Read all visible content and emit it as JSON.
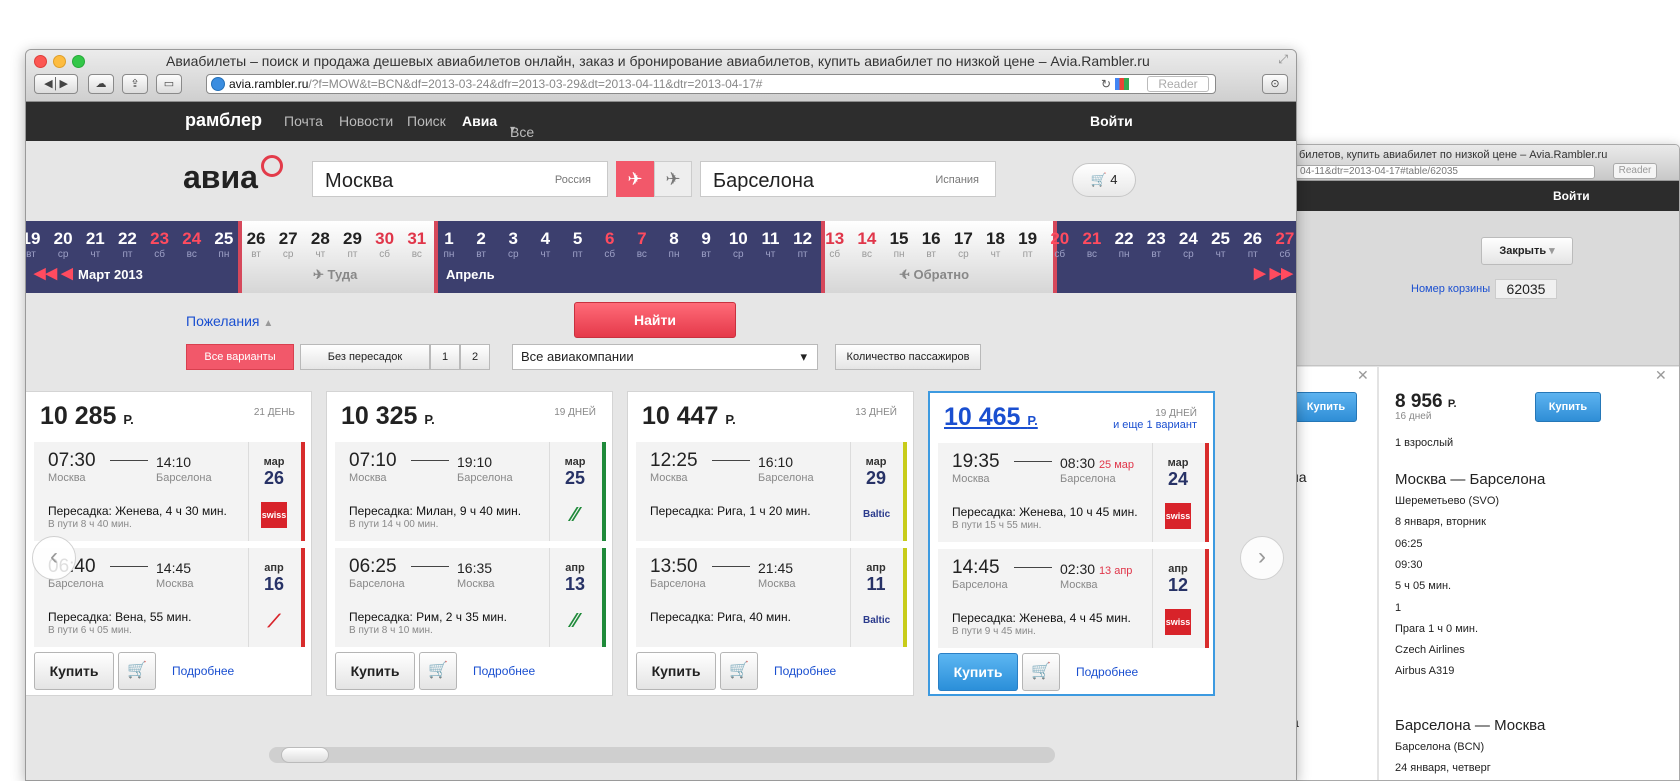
{
  "back_window": {
    "title": "билетов, купить авиабилет по низкой цене – Avia.Rambler.ru",
    "url": "04-11&dtr=2013-04-17#table/62035",
    "reader": "Reader",
    "login": "Войти",
    "close_label": "Закрыть",
    "basket_label": "Номер корзины",
    "basket_number": "62035",
    "buy_label": "Купить",
    "left_fragments": [
      "на",
      "а"
    ],
    "panel": {
      "price": "8 956",
      "currency": "Р.",
      "days": "16 дней",
      "passengers": "1 взрослый",
      "route1_title": "Москва — Барселона",
      "route1_lines": [
        "Шереметьево (SVO)",
        "8 января, вторник",
        "06:25",
        "09:30",
        "5 ч 05 мин.",
        "1",
        "Прага 1 ч 0 мин.",
        "Czech Airlines",
        "Airbus A319"
      ],
      "route2_title": "Барселона — Москва",
      "route2_lines": [
        "Барселона (BCN)",
        "24 января, четверг"
      ]
    }
  },
  "window": {
    "title": "Авиабилеты – поиск и продажа дешевых авиабилетов онлайн, заказ и бронирование авиабилетов, купить авиабилет по низкой цене – Avia.Rambler.ru",
    "url_host": "avia.rambler.ru",
    "url_rest": "/?f=MOW&t=BCN&df=2013-03-24&dfr=2013-03-29&dt=2013-04-11&dtr=2013-04-17#",
    "reader": "Reader"
  },
  "topnav": {
    "logo": "рамблер",
    "items": [
      "Почта",
      "Новости",
      "Поиск",
      "Авиа",
      "Все"
    ],
    "login": "Войти"
  },
  "search": {
    "logo": "авиа",
    "from_city": "Москва",
    "from_country": "Россия",
    "to_city": "Барселона",
    "to_country": "Испания",
    "cart_count": "4"
  },
  "dates": {
    "days": [
      {
        "n": "19",
        "w": "вт",
        "we": false
      },
      {
        "n": "20",
        "w": "ср",
        "we": false
      },
      {
        "n": "21",
        "w": "чт",
        "we": false
      },
      {
        "n": "22",
        "w": "пт",
        "we": false
      },
      {
        "n": "23",
        "w": "сб",
        "we": true
      },
      {
        "n": "24",
        "w": "вс",
        "we": true
      },
      {
        "n": "25",
        "w": "пн",
        "we": false
      },
      {
        "n": "26",
        "w": "вт",
        "we": false
      },
      {
        "n": "27",
        "w": "ср",
        "we": false
      },
      {
        "n": "28",
        "w": "чт",
        "we": false
      },
      {
        "n": "29",
        "w": "пт",
        "we": false
      },
      {
        "n": "30",
        "w": "сб",
        "we": true
      },
      {
        "n": "31",
        "w": "вс",
        "we": true
      },
      {
        "n": "1",
        "w": "пн",
        "we": false
      },
      {
        "n": "2",
        "w": "вт",
        "we": false
      },
      {
        "n": "3",
        "w": "ср",
        "we": false
      },
      {
        "n": "4",
        "w": "чт",
        "we": false
      },
      {
        "n": "5",
        "w": "пт",
        "we": false
      },
      {
        "n": "6",
        "w": "сб",
        "we": true
      },
      {
        "n": "7",
        "w": "вс",
        "we": true
      },
      {
        "n": "8",
        "w": "пн",
        "we": false
      },
      {
        "n": "9",
        "w": "вт",
        "we": false
      },
      {
        "n": "10",
        "w": "ср",
        "we": false
      },
      {
        "n": "11",
        "w": "чт",
        "we": false
      },
      {
        "n": "12",
        "w": "пт",
        "we": false
      },
      {
        "n": "13",
        "w": "сб",
        "we": true
      },
      {
        "n": "14",
        "w": "вс",
        "we": true
      },
      {
        "n": "15",
        "w": "пн",
        "we": false
      },
      {
        "n": "16",
        "w": "вт",
        "we": false
      },
      {
        "n": "17",
        "w": "ср",
        "we": false
      },
      {
        "n": "18",
        "w": "чт",
        "we": false
      },
      {
        "n": "19",
        "w": "пт",
        "we": false
      },
      {
        "n": "20",
        "w": "сб",
        "we": true
      },
      {
        "n": "21",
        "w": "вс",
        "we": true
      },
      {
        "n": "22",
        "w": "пн",
        "we": false
      },
      {
        "n": "23",
        "w": "вт",
        "we": false
      },
      {
        "n": "24",
        "w": "ср",
        "we": false
      },
      {
        "n": "25",
        "w": "чт",
        "we": false
      },
      {
        "n": "26",
        "w": "пт",
        "we": false
      },
      {
        "n": "27",
        "w": "сб",
        "we": true
      }
    ],
    "month1": "Март 2013",
    "month2": "Апрель",
    "there_label": "Туда",
    "back_label": "Обратно"
  },
  "options": {
    "wishes": "Пожелания",
    "find": "Найти",
    "all_variants": "Все варианты",
    "no_transfers": "Без пересадок",
    "one": "1",
    "two": "2",
    "airlines": "Все авиакомпании",
    "passengers": "Количество пассажиров"
  },
  "card_labels": {
    "buy": "Купить",
    "more": "Подробнее"
  },
  "cards": [
    {
      "price": "10 285",
      "cur": "Р.",
      "days": "21 ДЕНЬ",
      "extra": "",
      "legs": [
        {
          "dep": "07:30",
          "arr": "14:10",
          "arr_extra": "",
          "from": "Москва",
          "to": "Барселона",
          "transfer": "Пересадка: Женева, 4 ч 30 мин.",
          "dur": "В пути 8 ч 40 мин.",
          "mon": "мар",
          "day": "26",
          "logo": "swiss",
          "color": "#d82c2c"
        },
        {
          "dep": "06:40",
          "arr": "14:45",
          "arr_extra": "",
          "from": "Барселона",
          "to": "Москва",
          "transfer": "Пересадка: Вена, 55 мин.",
          "dur": "В пути 6 ч 05 мин.",
          "mon": "апр",
          "day": "16",
          "logo": "austrian",
          "color": "#d82c2c"
        }
      ]
    },
    {
      "price": "10 325",
      "cur": "Р.",
      "days": "19 ДНЕЙ",
      "extra": "",
      "legs": [
        {
          "dep": "07:10",
          "arr": "19:10",
          "arr_extra": "",
          "from": "Москва",
          "to": "Барселона",
          "transfer": "Пересадка: Милан, 9 ч 40 мин.",
          "dur": "В пути 14 ч 00 мин.",
          "mon": "мар",
          "day": "25",
          "logo": "alitalia",
          "color": "#1f8a3a"
        },
        {
          "dep": "06:25",
          "arr": "16:35",
          "arr_extra": "",
          "from": "Барселона",
          "to": "Москва",
          "transfer": "Пересадка: Рим, 2 ч 35 мин.",
          "dur": "В пути 8 ч 10 мин.",
          "mon": "апр",
          "day": "13",
          "logo": "alitalia",
          "color": "#1f8a3a"
        }
      ]
    },
    {
      "price": "10 447",
      "cur": "Р.",
      "days": "13 ДНЕЙ",
      "extra": "",
      "legs": [
        {
          "dep": "12:25",
          "arr": "16:10",
          "arr_extra": "",
          "from": "Москва",
          "to": "Барселона",
          "transfer": "Пересадка: Рига, 1 ч 20 мин.",
          "dur": "",
          "mon": "мар",
          "day": "29",
          "logo": "baltic",
          "color": "#c8cc1a"
        },
        {
          "dep": "13:50",
          "arr": "21:45",
          "arr_extra": "",
          "from": "Барселона",
          "to": "Москва",
          "transfer": "Пересадка: Рига, 40 мин.",
          "dur": "",
          "mon": "апр",
          "day": "11",
          "logo": "baltic",
          "color": "#c8cc1a"
        }
      ]
    },
    {
      "price": "10 465",
      "cur": "Р.",
      "days": "19 ДНЕЙ",
      "extra": "и еще 1 вариант",
      "legs": [
        {
          "dep": "19:35",
          "arr": "08:30",
          "arr_extra": "25 мар",
          "from": "Москва",
          "to": "Барселона",
          "transfer": "Пересадка: Женева, 10 ч 45 мин.",
          "dur": "В пути 15 ч 55 мин.",
          "mon": "мар",
          "day": "24",
          "logo": "swiss",
          "color": "#d82c2c"
        },
        {
          "dep": "14:45",
          "arr": "02:30",
          "arr_extra": "13 апр",
          "from": "Барселона",
          "to": "Москва",
          "transfer": "Пересадка: Женева, 4 ч 45 мин.",
          "dur": "В пути 9 ч 45 мин.",
          "mon": "апр",
          "day": "12",
          "logo": "swiss",
          "color": "#d82c2c"
        }
      ]
    }
  ]
}
